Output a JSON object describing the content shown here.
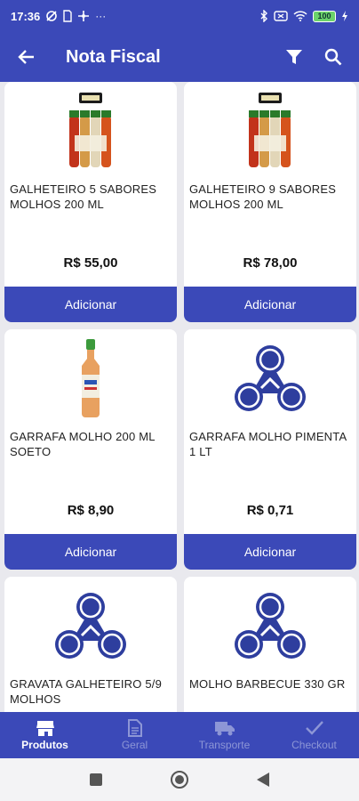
{
  "status": {
    "time": "17:36",
    "more": "···",
    "battery": "100"
  },
  "appbar": {
    "title": "Nota Fiscal"
  },
  "products": [
    {
      "name": "GALHETEIRO 5 SABORES MOLHOS 200 ML",
      "price": "R$ 55,00",
      "button": "Adicionar",
      "image": "sauce-bottles-pack"
    },
    {
      "name": "GALHETEIRO 9 SABORES MOLHOS 200 ML",
      "price": "R$ 78,00",
      "button": "Adicionar",
      "image": "sauce-bottles-pack"
    },
    {
      "name": "GARRAFA MOLHO 200 ML SOETO",
      "price": "R$ 8,90",
      "button": "Adicionar",
      "image": "sauce-bottle"
    },
    {
      "name": "GARRAFA MOLHO PIMENTA 1 LT",
      "price": "R$ 0,71",
      "button": "Adicionar",
      "image": "placeholder-logo"
    },
    {
      "name": "GRAVATA GALHETEIRO 5/9 MOLHOS",
      "price": "",
      "button": "",
      "image": "placeholder-logo"
    },
    {
      "name": "MOLHO BARBECUE 330 GR",
      "price": "",
      "button": "",
      "image": "placeholder-logo"
    }
  ],
  "bottom_nav": {
    "tabs": [
      {
        "label": "Produtos",
        "icon": "store-icon",
        "active": true
      },
      {
        "label": "Geral",
        "icon": "document-icon",
        "active": false
      },
      {
        "label": "Transporte",
        "icon": "truck-icon",
        "active": false
      },
      {
        "label": "Checkout",
        "icon": "check-icon",
        "active": false
      }
    ]
  },
  "colors": {
    "primary": "#3b49b8",
    "inactive_tab": "#8d96d6"
  }
}
